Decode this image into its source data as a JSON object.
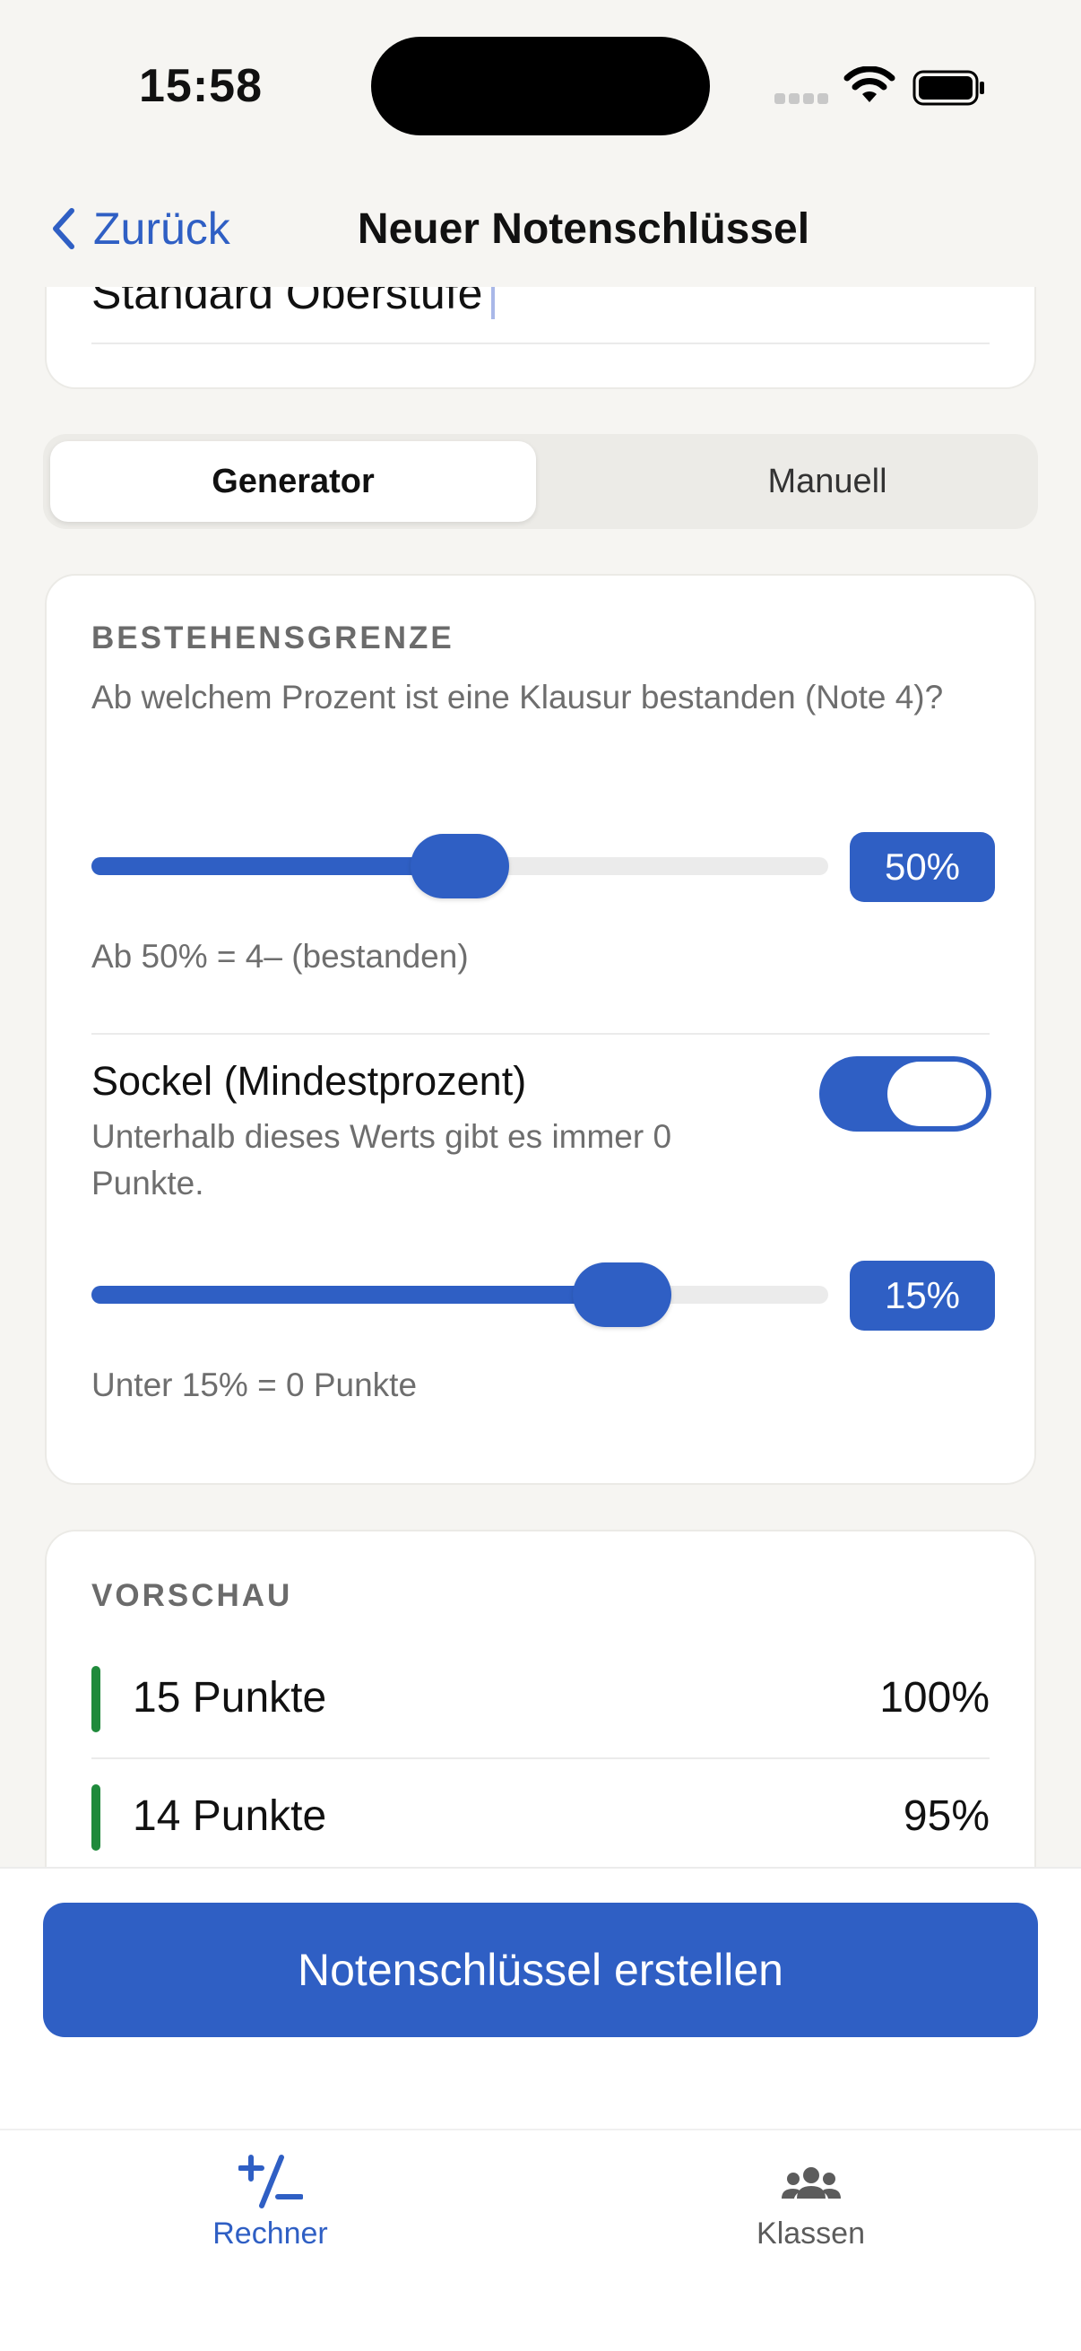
{
  "status_bar": {
    "time": "15:58"
  },
  "nav": {
    "back_label": "Zurück",
    "title": "Neuer Notenschlüssel"
  },
  "name_field": {
    "value": "Standard Oberstufe"
  },
  "mode_tabs": [
    {
      "label": "Generator",
      "selected": true
    },
    {
      "label": "Manuell",
      "selected": false
    }
  ],
  "pass_threshold": {
    "section_label": "BESTEHENSGRENZE",
    "description": "Ab welchem Prozent ist eine Klausur bestanden (Note 4)?",
    "slider_value_percent": 50,
    "value_label": "50%",
    "hint": "Ab 50% = 4– (bestanden)"
  },
  "sockel": {
    "title": "Sockel (Mindestprozent)",
    "description": "Unterhalb dieses Werts gibt es immer 0 Punkte.",
    "enabled": true,
    "slider_value_percent": 72,
    "value_label": "15%",
    "hint": "Unter 15% = 0 Punkte"
  },
  "preview": {
    "section_label": "VORSCHAU",
    "rows": [
      {
        "label": "15 Punkte",
        "value": "100%"
      },
      {
        "label": "14 Punkte",
        "value": "95%"
      }
    ]
  },
  "primary_action": {
    "label": "Notenschlüssel erstellen"
  },
  "tab_bar": {
    "items": [
      {
        "label": "Rechner",
        "icon": "plus-minus-icon",
        "active": true
      },
      {
        "label": "Klassen",
        "icon": "people-icon",
        "active": false
      }
    ]
  },
  "colors": {
    "accent": "#2f5fc4",
    "success": "#1f8a3b",
    "background": "#f6f5f2"
  }
}
